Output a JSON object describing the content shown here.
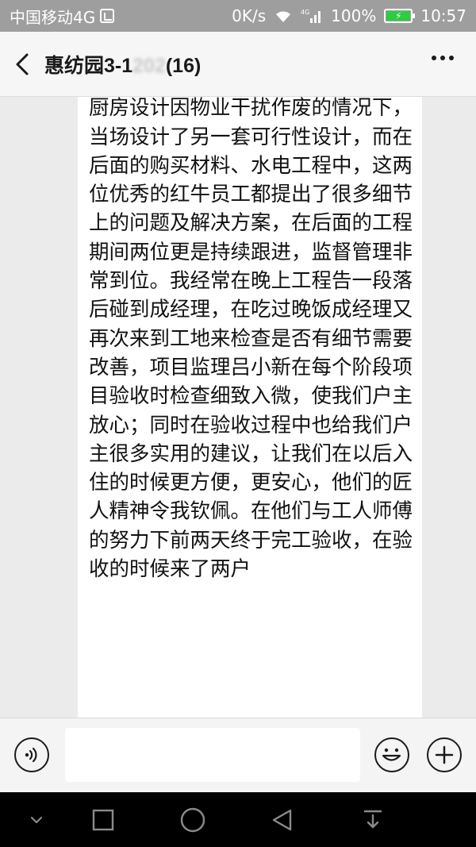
{
  "status_bar": {
    "carrier": "中国移动4G",
    "speed": "0K/s",
    "network": "4G",
    "battery": "100%",
    "time": "10:57"
  },
  "header": {
    "title_visible": "惠纺园3-1",
    "title_blurred": "202",
    "member_count": "(16)"
  },
  "message": {
    "text": "工作，很热情地的与我讲解，在原先厨房设计因物业干扰作废的情况下，当场设计了另一套可行性设计，而在后面的购买材料、水电工程中，这两位优秀的红牛员工都提出了很多细节上的问题及解决方案，在后面的工程期间两位更是持续跟进，监督管理非常到位。我经常在晚上工程告一段落后碰到成经理，在吃过晚饭成经理又再次来到工地来检查是否有细节需要改善，项目监理吕小新在每个阶段项目验收时检查细致入微，使我们户主放心；同时在验收过程中也给我们户主很多实用的建议，让我们在以后入住的时候更方便，更安心，他们的匠人精神令我钦佩。在他们与工人师傅的努力下前两天终于完工验收，在验收的时候来了两户"
  },
  "input_bar": {
    "placeholder": ""
  },
  "icons": {
    "back": "back-arrow-icon",
    "more": "more-dots-icon",
    "voice": "voice-icon",
    "emoji": "emoji-icon",
    "plus": "plus-icon"
  },
  "colors": {
    "status_bar_bg": "#9e9e9e",
    "header_bg": "#f6f6f6",
    "chat_bg": "#ebebeb",
    "bubble_bg": "#ffffff",
    "battery_fill": "#2ecc40",
    "nav_bg": "#000000"
  }
}
